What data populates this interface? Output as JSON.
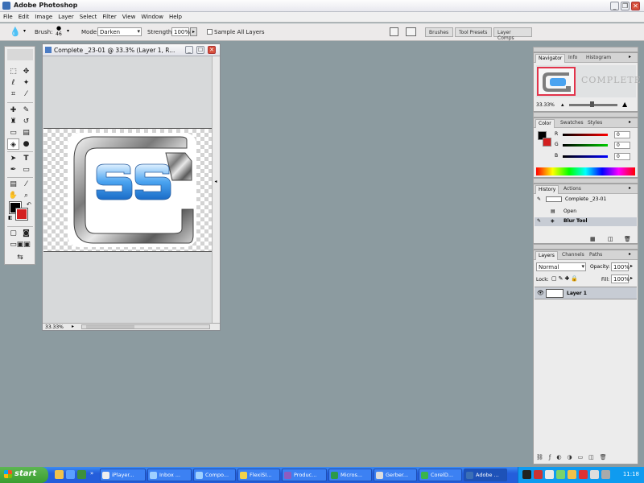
{
  "app": {
    "title": "Adobe Photoshop"
  },
  "menu": [
    "File",
    "Edit",
    "Image",
    "Layer",
    "Select",
    "Filter",
    "View",
    "Window",
    "Help"
  ],
  "options": {
    "brush_label": "Brush:",
    "brush_size": "46",
    "mode_label": "Mode:",
    "mode_value": "Darken",
    "strength_label": "Strength:",
    "strength_value": "100%",
    "sample_all_layers": "Sample All Layers",
    "palette_well": [
      "Brushes",
      "Tool Presets",
      "Layer Comps"
    ]
  },
  "document": {
    "title": "Complete _23-01 @ 33.3% (Layer 1, R...",
    "zoom": "33.33%"
  },
  "navigator": {
    "tabs": [
      "Navigator",
      "Info",
      "Histogram"
    ],
    "preview_text": "COMPLETE",
    "zoom": "33.33%"
  },
  "color": {
    "tabs": [
      "Color",
      "Swatches",
      "Styles"
    ],
    "channels": [
      {
        "label": "R",
        "value": "0"
      },
      {
        "label": "G",
        "value": "0"
      },
      {
        "label": "B",
        "value": "0"
      }
    ]
  },
  "history": {
    "tabs": [
      "History",
      "Actions"
    ],
    "snapshot": "Complete _23-01",
    "items": [
      "Open",
      "Blur Tool"
    ]
  },
  "layers": {
    "tabs": [
      "Layers",
      "Channels",
      "Paths"
    ],
    "blend_mode": "Normal",
    "opacity_label": "Opacity:",
    "opacity_value": "100%",
    "lock_label": "Lock:",
    "fill_label": "Fill:",
    "fill_value": "100%",
    "layer_name": "Layer 1"
  },
  "taskbar": {
    "start": "start",
    "buttons": [
      "iPlayer...",
      "Inbox ...",
      "Compo...",
      "FlexiSI...",
      "Produc...",
      "Micros...",
      "Gerber...",
      "CorelD...",
      "Adobe ..."
    ],
    "clock": "11:18"
  },
  "colors": {
    "foreground": "#000000",
    "background": "#d31f1f",
    "workspace": "#8c9ba0",
    "taskbar": "#245edb"
  }
}
